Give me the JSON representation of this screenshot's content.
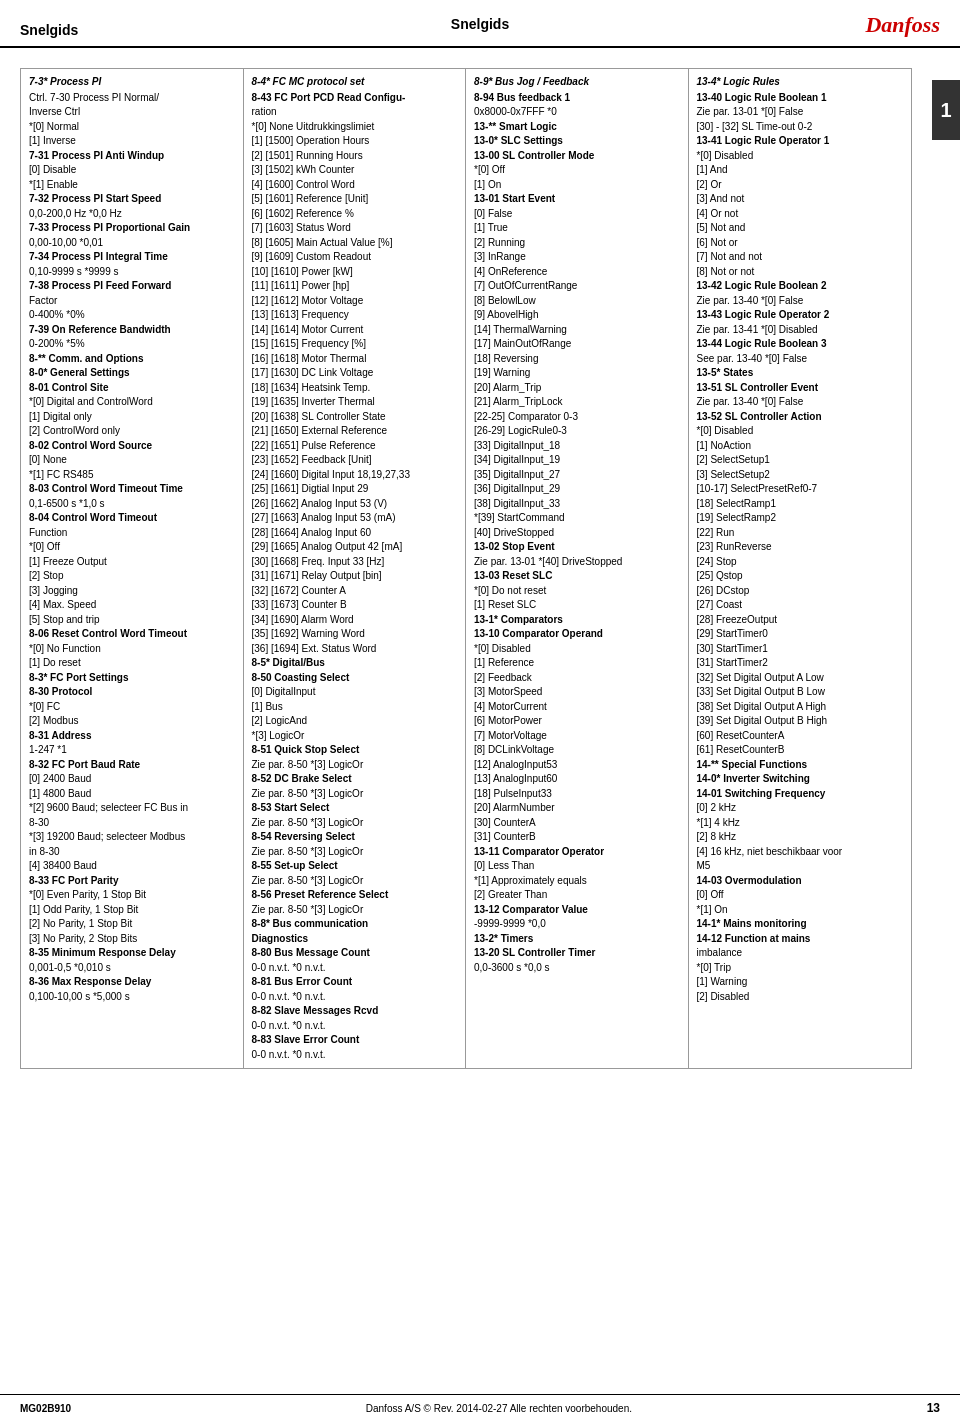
{
  "header": {
    "left_title": "Snelgids",
    "center_title": "Snelgids",
    "logo": "Danfoss"
  },
  "side_tab": {
    "label": "1"
  },
  "footer": {
    "left": "MG02B910",
    "center": "Danfoss A/S © Rev. 2014-02-27 Alle rechten voorbehouden.",
    "right": "13"
  },
  "columns": [
    {
      "sections": [
        {
          "title": "7-3* Process PI",
          "lines": [
            "Ctrl. 7-30 Process PI Normal/",
            "Inverse Ctrl",
            "*[0] Normal",
            "[1] Inverse",
            "7-31 Process PI Anti Windup",
            "[0] Disable",
            "*[1] Enable",
            "7-32 Process PI Start Speed",
            "0,0-200,0 Hz *0,0 Hz",
            "7-33 Process PI Proportional Gain",
            "0,00-10,00 *0,01",
            "7-34 Process PI Integral Time",
            "0,10-9999 s *9999 s",
            "7-38 Process PI Feed Forward",
            "Factor",
            "0-400% *0%",
            "7-39 On Reference Bandwidth",
            "0-200% *5%",
            "8-** Comm. and Options",
            "8-0* General Settings",
            "8-01 Control Site",
            "*[0] Digital and ControlWord",
            "[1] Digital only",
            "[2] ControlWord only",
            "8-02 Control Word Source",
            "[0] None",
            "*[1] FC RS485",
            "8-03 Control Word Timeout Time",
            "0,1-6500 s *1,0 s",
            "8-04 Control Word Timeout",
            "Function",
            "*[0] Off",
            "[1] Freeze Output",
            "[2] Stop",
            "[3] Jogging",
            "[4] Max. Speed",
            "[5] Stop and trip",
            "8-06 Reset Control Word Timeout",
            "*[0] No Function",
            "[1] Do reset",
            "8-3* FC Port Settings",
            "8-30 Protocol",
            "*[0] FC",
            "[2] Modbus",
            "8-31 Address",
            "1-247 *1",
            "8-32 FC Port Baud Rate",
            "[0] 2400 Baud",
            "[1] 4800 Baud",
            "*[2] 9600 Baud; selecteer FC Bus in",
            "8-30",
            "*[3] 19200 Baud; selecteer Modbus",
            "in 8-30",
            "[4] 38400 Baud",
            "8-33 FC Port Parity",
            "*[0] Even Parity, 1 Stop Bit",
            "[1] Odd Parity, 1 Stop Bit",
            "[2] No Parity, 1 Stop Bit",
            "[3] No Parity, 2 Stop Bits",
            "8-35 Minimum Response Delay",
            "0,001-0,5 *0,010 s",
            "8-36 Max Response Delay",
            "0,100-10,00 s *5,000 s"
          ]
        }
      ]
    },
    {
      "sections": [
        {
          "title": "8-4* FC MC protocol set",
          "lines": [
            "8-43 FC Port PCD Read Configu-",
            "ration",
            "*[0] None Uitdrukkingslimiet",
            "[1] [1500] Operation Hours",
            "[2] [1501] Running Hours",
            "[3] [1502] kWh Counter",
            "[4] [1600] Control Word",
            "[5] [1601] Reference [Unit]",
            "[6] [1602] Reference %",
            "[7] [1603] Status Word",
            "[8] [1605] Main Actual Value [%]",
            "[9] [1609] Custom Readout",
            "[10] [1610] Power [kW]",
            "[11] [1611] Power [hp]",
            "[12] [1612] Motor Voltage",
            "[13] [1613] Frequency",
            "[14] [1614] Motor Current",
            "[15] [1615] Frequency [%]",
            "[16] [1618] Motor Thermal",
            "[17] [1630] DC Link Voltage",
            "[18] [1634] Heatsink Temp.",
            "[19] [1635] Inverter Thermal",
            "[20] [1638] SL Controller State",
            "[21] [1650] External Reference",
            "[22] [1651] Pulse Reference",
            "[23] [1652] Feedback [Unit]",
            "[24] [1660] Digital Input 18,19,27,33",
            "[25] [1661] Digtial Input 29",
            "[26] [1662] Analog Input 53 (V)",
            "[27] [1663] Analog Input 53 (mA)",
            "[28] [1664] Analog Input 60",
            "[29] [1665] Analog Output 42 [mA]",
            "[30] [1668] Freq. Input 33 [Hz]",
            "[31] [1671] Relay Output [bin]",
            "[32] [1672] Counter A",
            "[33] [1673] Counter B",
            "[34] [1690] Alarm Word",
            "[35] [1692] Warning Word",
            "[36] [1694] Ext. Status Word",
            "8-5* Digital/Bus",
            "8-50 Coasting Select",
            "[0] DigitalInput",
            "[1] Bus",
            "[2] LogicAnd",
            "*[3] LogicOr",
            "8-51 Quick Stop Select",
            "Zie par. 8-50 *[3] LogicOr",
            "8-52 DC Brake Select",
            "Zie par. 8-50 *[3] LogicOr",
            "8-53 Start Select",
            "Zie par. 8-50 *[3] LogicOr",
            "8-54 Reversing Select",
            "Zie par. 8-50 *[3] LogicOr",
            "8-55 Set-up Select",
            "Zie par. 8-50 *[3] LogicOr",
            "8-56 Preset Reference Select",
            "Zie par. 8-50 *[3] LogicOr",
            "8-8* Bus communication",
            "Diagnostics",
            "8-80 Bus Message Count",
            "0-0 n.v.t. *0 n.v.t.",
            "8-81 Bus Error Count",
            "0-0 n.v.t. *0 n.v.t.",
            "8-82 Slave Messages Rcvd",
            "0-0 n.v.t. *0 n.v.t.",
            "8-83 Slave Error Count",
            "0-0 n.v.t. *0 n.v.t."
          ]
        }
      ]
    },
    {
      "sections": [
        {
          "title": "8-9* Bus Jog / Feedback",
          "lines": [
            "8-94 Bus feedback 1",
            "0x8000-0x7FFF *0",
            "13-** Smart Logic",
            "13-0* SLC Settings",
            "13-00 SL Controller Mode",
            "*[0] Off",
            "[1] On",
            "13-01 Start Event",
            "[0] False",
            "[1] True",
            "[2] Running",
            "[3] InRange",
            "[4] OnReference",
            "[7] OutOfCurrentRange",
            "[8] BelowlLow",
            "[9] AbovelHigh",
            "[14] ThermalWarning",
            "[17] MainOutOfRange",
            "[18] Reversing",
            "[19] Warning",
            "[20] Alarm_Trip",
            "[21] Alarm_TripLock",
            "[22-25] Comparator 0-3",
            "[26-29] LogicRule0-3",
            "[33] DigitalInput_18",
            "[34] DigitalInput_19",
            "[35] DigitalInput_27",
            "[36] DigitalInput_29",
            "[38] DigitalInput_33",
            "*[39] StartCommand",
            "[40] DriveStopped",
            "13-02 Stop Event",
            "Zie par. 13-01 *[40] DriveStopped",
            "13-03 Reset SLC",
            "*[0] Do not reset",
            "[1] Reset SLC",
            "13-1* Comparators",
            "13-10 Comparator Operand",
            "*[0] Disabled",
            "[1] Reference",
            "[2] Feedback",
            "[3] MotorSpeed",
            "[4] MotorCurrent",
            "[6] MotorPower",
            "[7] MotorVoltage",
            "[8] DCLinkVoltage",
            "[12] AnalogInput53",
            "[13] AnalogInput60",
            "[18] PulseInput33",
            "[20] AlarmNumber",
            "[30] CounterA",
            "[31] CounterB",
            "13-11 Comparator Operator",
            "[0] Less Than",
            "*[1] Approximately equals",
            "[2] Greater Than",
            "13-12 Comparator Value",
            "-9999-9999 *0,0",
            "13-2* Timers",
            "13-20 SL Controller Timer",
            "0,0-3600 s *0,0 s"
          ]
        }
      ]
    },
    {
      "sections": [
        {
          "title": "13-4* Logic Rules",
          "lines": [
            "13-40 Logic Rule Boolean 1",
            "Zie par. 13-01 *[0] False",
            "[30] - [32] SL Time-out 0-2",
            "13-41 Logic Rule Operator 1",
            "*[0] Disabled",
            "[1] And",
            "[2] Or",
            "[3] And not",
            "[4] Or not",
            "[5] Not and",
            "[6] Not or",
            "[7] Not and not",
            "[8] Not or not",
            "13-42 Logic Rule Boolean 2",
            "Zie par. 13-40 *[0] False",
            "13-43 Logic Rule Operator 2",
            "Zie par. 13-41 *[0] Disabled",
            "13-44 Logic Rule Boolean 3",
            "See par. 13-40 *[0] False",
            "13-5* States",
            "13-51 SL Controller Event",
            "Zie par. 13-40 *[0] False",
            "13-52 SL Controller Action",
            "*[0] Disabled",
            "[1] NoAction",
            "[2] SelectSetup1",
            "[3] SelectSetup2",
            "[10-17] SelectPresetRef0-7",
            "[18] SelectRamp1",
            "[19] SelectRamp2",
            "[22] Run",
            "[23] RunReverse",
            "[24] Stop",
            "[25] Qstop",
            "[26] DCstop",
            "[27] Coast",
            "[28] FreezeOutput",
            "[29] StartTimer0",
            "[30] StartTimer1",
            "[31] StartTimer2",
            "[32] Set Digital Output A Low",
            "[33] Set Digital Output B Low",
            "[38] Set Digital Output A High",
            "[39] Set Digital Output B High",
            "[60] ResetCounterA",
            "[61] ResetCounterB",
            "14-** Special Functions",
            "14-0* Inverter Switching",
            "14-01 Switching Frequency",
            "[0] 2 kHz",
            "*[1] 4 kHz",
            "[2] 8 kHz",
            "[4] 16 kHz, niet beschikbaar voor",
            "M5",
            "14-03 Overmodulation",
            "[0] Off",
            "*[1] On",
            "14-1* Mains monitoring",
            "14-12 Function at mains",
            "imbalance",
            "*[0] Trip",
            "[1] Warning",
            "[2] Disabled"
          ]
        }
      ]
    }
  ]
}
